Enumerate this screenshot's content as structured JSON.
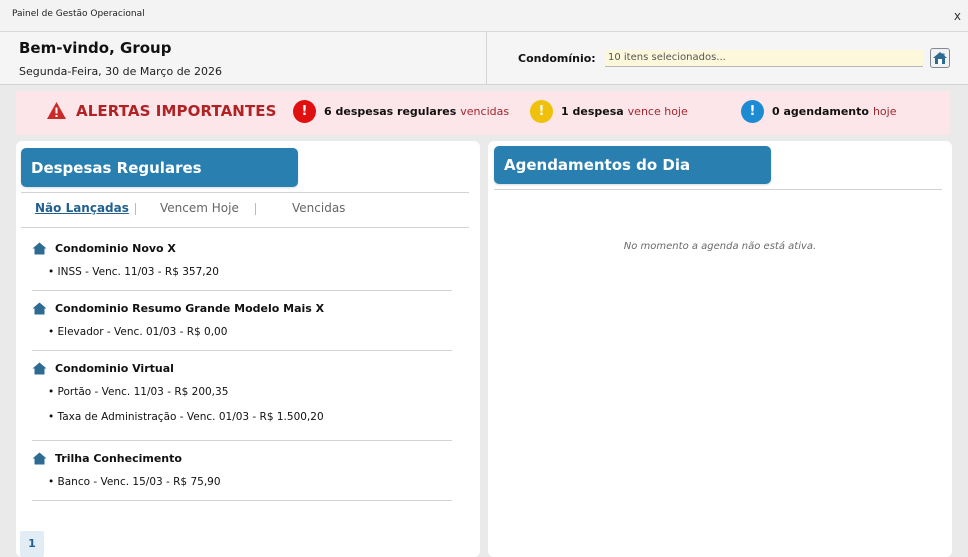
{
  "window": {
    "title": "Painel de Gestão Operacional",
    "close_label": "x"
  },
  "header": {
    "welcome": "Bem-vindo, Group",
    "date": "Segunda-Feira, 30 de Março de 2026",
    "condo_label": "Condomínio:",
    "condo_value": "10 itens selecionados..."
  },
  "alerts": {
    "title": "ALERTAS IMPORTANTES",
    "items": [
      {
        "count_text": "6 despesas regulares",
        "status": "vencidas",
        "color": "#e01010",
        "icon": "!"
      },
      {
        "count_text": "1 despesa",
        "status": "vence hoje",
        "color": "#f0c10a",
        "icon": "!"
      },
      {
        "count_text": "0 agendamento",
        "status": "hoje",
        "color": "#1c8bd1",
        "icon": "!"
      }
    ]
  },
  "expenses": {
    "title": "Despesas Regulares",
    "tabs": [
      "Não Lançadas",
      "Vencem Hoje",
      "Vencidas"
    ],
    "active_tab": "Não Lançadas",
    "condos": [
      {
        "name": "Condominio Novo X",
        "items": [
          "• INSS - Venc. 11/03 - R$ 357,20"
        ]
      },
      {
        "name": "Condominio Resumo Grande Modelo Mais X",
        "items": [
          "• Elevador - Venc. 01/03 - R$ 0,00"
        ]
      },
      {
        "name": "Condominio Virtual",
        "items": [
          "• Portão - Venc. 11/03 - R$ 200,35",
          "• Taxa de Administração - Venc. 01/03 - R$ 1.500,20"
        ]
      },
      {
        "name": "Trilha Conhecimento",
        "items": [
          "• Banco - Venc. 15/03 - R$ 75,90"
        ]
      }
    ],
    "page": "1"
  },
  "schedule": {
    "title": "Agendamentos do Dia",
    "empty_message": "No momento a agenda não está ativa."
  },
  "colors": {
    "accent": "#2a7fb1",
    "alert_bg": "#fce6ea",
    "alert_text": "#b02223"
  }
}
